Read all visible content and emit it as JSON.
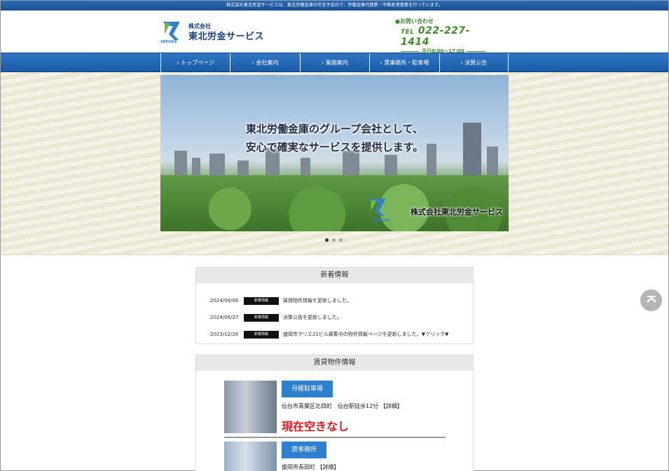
{
  "topbar": {
    "text": "株式会社東北労金サービスは、東北労働金庫の完全子会社で、労働金庫代理業・不動産賃借業を行っています。"
  },
  "logo": {
    "kabushiki": "株式会社",
    "company": "東北労金サービス",
    "mark": "SERVICE"
  },
  "contact": {
    "label": "●お問い合わせ",
    "tel_prefix": "TEL",
    "tel": "022-227-1414",
    "hours": "平日9:00～17:00"
  },
  "nav": {
    "items": [
      "トップページ",
      "会社案内",
      "業務案内",
      "賃事務所・駐車場",
      "決算公告"
    ]
  },
  "hero": {
    "line1": "東北労働金庫のグループ会社として、",
    "line2": "安心で確実なサービスを提供します。",
    "corp": "株式会社東北労金サービス",
    "mark": "SERVICE"
  },
  "news": {
    "title": "新着情報",
    "items": [
      {
        "date": "2024/08/06",
        "tag": "新着情報",
        "text": "賃貸物件情報を更新しました。"
      },
      {
        "date": "2024/06/27",
        "tag": "新着情報",
        "text": "決算公告を更新しました。"
      },
      {
        "date": "2023/12/26",
        "tag": "新着情報",
        "text": "盛岡市クリエ21ビル募集中の物件情報ページを更新しました。▼クリック▼"
      }
    ]
  },
  "rent": {
    "title": "賃貸物件情報",
    "items": [
      {
        "badge": "月極駐車場",
        "address": "仙台市青葉区北目町　仙台駅徒歩12分 【詳細】",
        "status": "現在空きなし"
      },
      {
        "badge": "貸事務所",
        "address": "盛岡市長田町 【詳細】",
        "status": ""
      }
    ]
  },
  "colors": {
    "accent_blue": "#2d7fd0",
    "nav_blue": "#1a5aa6",
    "green": "#3e8c27",
    "red": "#e1141e"
  },
  "icons": {
    "back_to_top": "chevron-up-icon"
  }
}
